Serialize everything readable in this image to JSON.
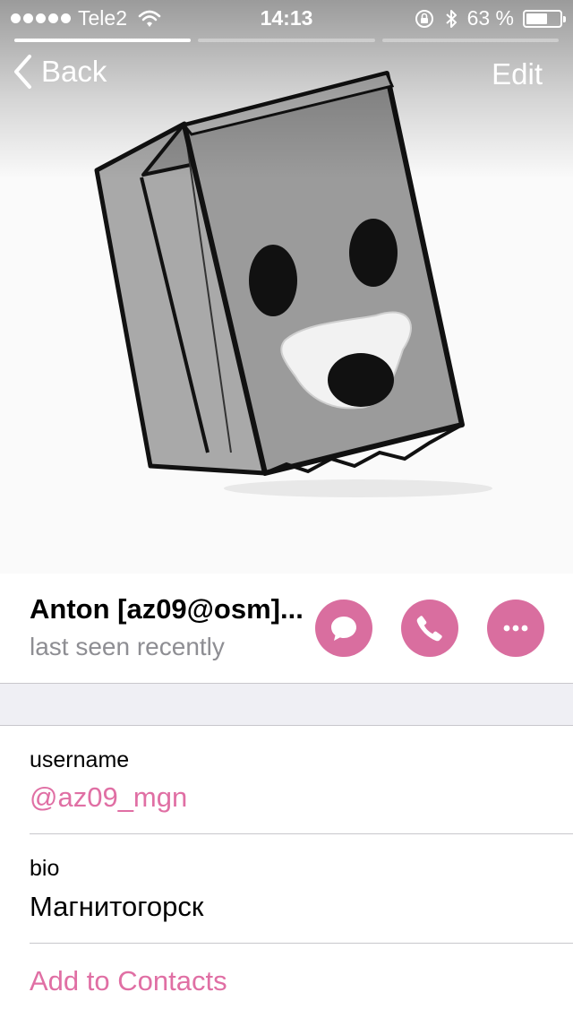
{
  "status_bar": {
    "carrier": "Tele2",
    "time": "14:13",
    "battery_percent": "63 %",
    "battery_level": 0.63
  },
  "photo_pager": {
    "count": 3,
    "active_index": 0
  },
  "nav": {
    "back_label": "Back",
    "edit_label": "Edit"
  },
  "profile": {
    "name": "Anton [az09@osm]...",
    "status": "last seen recently",
    "actions": [
      "message-icon",
      "phone-icon",
      "more-icon"
    ]
  },
  "info": {
    "username_label": "username",
    "username_value": "@az09_mgn",
    "bio_label": "bio",
    "bio_value": "Магнитогорск",
    "add_contact_label": "Add to Contacts"
  },
  "colors": {
    "accent": "#e06fa4",
    "action_button": "#d96e9f",
    "section_bg": "#efeff4",
    "secondary_text": "#8e8e93"
  }
}
